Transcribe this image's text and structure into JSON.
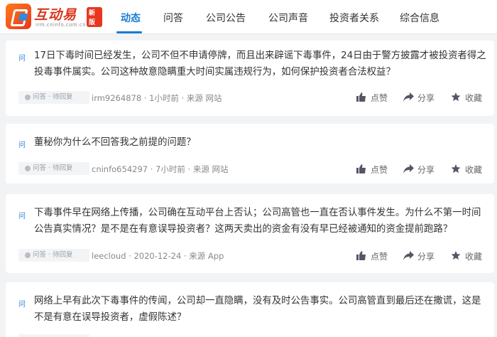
{
  "header": {
    "logo_title": "互动易",
    "logo_sub": "irm.cninfo.com.cn",
    "logo_badge": "新版",
    "tabs": [
      "动态",
      "问答",
      "公司公告",
      "公司声音",
      "投资者关系",
      "综合信息"
    ],
    "active_tab": "动态"
  },
  "questions": [
    {
      "marker": "问",
      "text": "17日下毒时间已经发生，公司不但不申请停牌，而且出来辟谣下毒事件，24日由于警方披露才被投资者得之投毒事件属实。公司这种故意隐瞒重大时间实属违规行为，如何保护投资者合法权益？",
      "status": "问答 · 待回复",
      "meta": "irm9264878 · 1小时前 · 来源 网站",
      "like": "点赞",
      "share": "分享",
      "fav": "收藏"
    },
    {
      "marker": "问",
      "text": "董秘你为什么不回答我之前提的问题？",
      "status": "问答 · 待回复",
      "meta": "cninfo654297 · 7小时前 · 来源 网站",
      "like": "点赞",
      "share": "分享",
      "fav": "收藏"
    },
    {
      "marker": "问",
      "text": "下毒事件早在网络上传播，公司确在互动平台上否认；公司高管也一直在否认事件发生。为什么不第一时间公告真实情况？是不是在有意误导投资者？这两天卖出的资金有没有早已经被通知的资金提前跑路？",
      "status": "问答 · 待回复",
      "meta": "leecloud · 2020-12-24 · 来源 App",
      "like": "点赞",
      "share": "分享",
      "fav": "收藏"
    },
    {
      "marker": "问",
      "text": "网络上早有此次下毒事件的传闻，公司却一直隐瞒，没有及时公告事实。公司高管直到最后还在撒谎，这是不是有意在误导投资者，虚假陈述？",
      "status": "",
      "meta": "",
      "like": "",
      "share": "",
      "fav": ""
    }
  ]
}
